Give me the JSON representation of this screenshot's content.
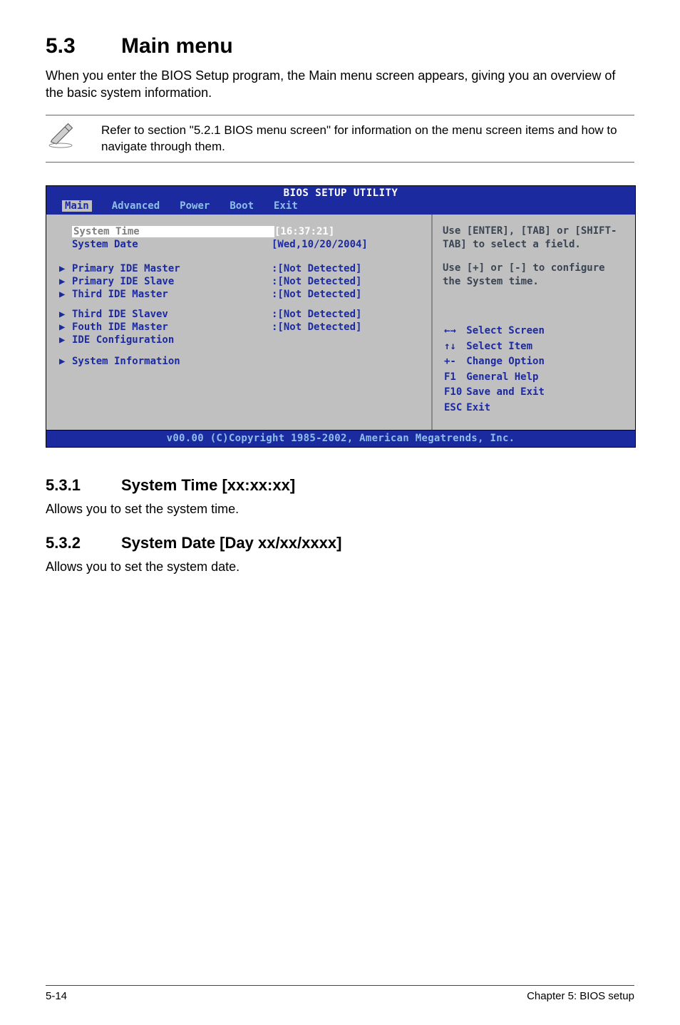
{
  "heading": {
    "num": "5.3",
    "title": "Main menu"
  },
  "intro": "When you enter the BIOS Setup program, the Main menu screen appears, giving you an overview of the basic system information.",
  "note": "Refer to section \"5.2.1  BIOS menu screen\" for information on the menu screen items and how to navigate through them.",
  "bios": {
    "title": "BIOS SETUP UTILITY",
    "menu": [
      "Main",
      "Advanced",
      "Power",
      "Boot",
      "Exit"
    ],
    "menu_selected": "Main",
    "left_rows": [
      {
        "type": "field",
        "selected": true,
        "label": "System Time",
        "value": "[16:37:21]"
      },
      {
        "type": "field",
        "label": "System Date",
        "value": "[Wed,10/20/2004]"
      },
      {
        "type": "gap"
      },
      {
        "type": "sub",
        "label": "Primary IDE Master",
        "value": ":[Not Detected]"
      },
      {
        "type": "sub",
        "label": "Primary IDE Slave",
        "value": ":[Not Detected]"
      },
      {
        "type": "sub",
        "label": "Third IDE Master",
        "value": ":[Not Detected]"
      },
      {
        "type": "gap-small"
      },
      {
        "type": "sub",
        "label": "Third IDE Slavev",
        "value": ":[Not Detected]"
      },
      {
        "type": "sub",
        "label": "Fouth IDE Master",
        "value": ":[Not Detected]"
      },
      {
        "type": "sub",
        "label": "IDE Configuration",
        "value": ""
      },
      {
        "type": "gap-small"
      },
      {
        "type": "sub",
        "label": "System Information",
        "value": ""
      }
    ],
    "help1": "Use [ENTER], [TAB] or [SHIFT-TAB] to select a field.",
    "help2": "Use [+] or [-] to configure the System time.",
    "legend": [
      {
        "k": "←→",
        "v": "Select Screen"
      },
      {
        "k": "↑↓",
        "v": "Select Item"
      },
      {
        "k": "+-",
        "v": "Change Option"
      },
      {
        "k": "F1",
        "v": "General Help"
      },
      {
        "k": "F10",
        "v": "Save and Exit"
      },
      {
        "k": "ESC",
        "v": "Exit"
      }
    ],
    "footer": "v00.00 (C)Copyright 1985-2002, American Megatrends, Inc."
  },
  "sec1": {
    "num": "5.3.1",
    "title": "System Time [xx:xx:xx]",
    "body": "Allows you to set the system time."
  },
  "sec2": {
    "num": "5.3.2",
    "title": "System Date [Day xx/xx/xxxx]",
    "body": "Allows you to set the system date."
  },
  "pagefoot": {
    "left": "5-14",
    "right": "Chapter 5: BIOS setup"
  }
}
